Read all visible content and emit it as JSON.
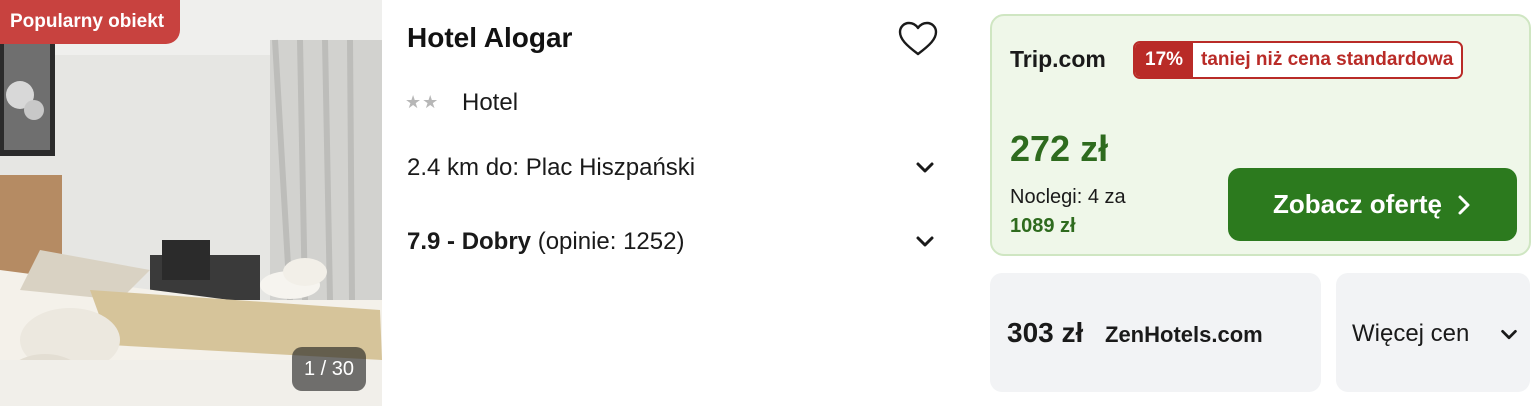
{
  "photo": {
    "badge": "Popularny obiekt",
    "counter": "1 / 30"
  },
  "hotel": {
    "name": "Hotel Alogar",
    "stars_display": "★★",
    "type": "Hotel",
    "distance": "2.4 km do: Plac Hiszpański",
    "rating_score": "7.9 - Dobry",
    "rating_reviews": "(opinie: 1252)"
  },
  "deal": {
    "provider": "Trip.com",
    "discount_pct": "17%",
    "discount_label": "taniej niż cena standardowa",
    "price": "272 zł",
    "nights": "Noclegi: 4 za",
    "total": "1089 zł",
    "cta": "Zobacz ofertę"
  },
  "alt_offer": {
    "price": "303 zł",
    "provider": "ZenHotels.com"
  },
  "more_prices": "Więcej cen",
  "colors": {
    "badge_red": "#c8423f",
    "discount_red": "#b92b27",
    "price_green": "#2e6b1e",
    "cta_green": "#2c7a1e",
    "deal_bg": "#eff7e9"
  }
}
